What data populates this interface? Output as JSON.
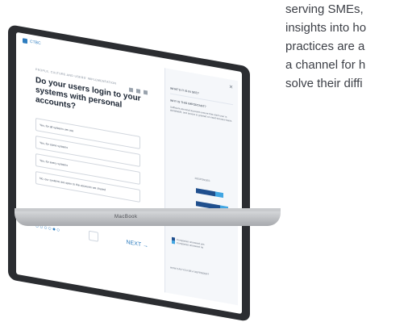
{
  "laptop_label": "MacBook",
  "brand": "CTBC",
  "question": {
    "kicker": "PEOPLE, CULTURE AND USERS' IMPLEMENTATION",
    "title": "Do your users login to your systems with personal accounts?",
    "options": [
      "Yes, for all systems we use",
      "Yes, for some systems",
      "Yes, for every systems",
      "No, our systems are open to the accounts we shared"
    ],
    "next_label": "NEXT →"
  },
  "side_panel": {
    "section1": "WHAT'S IT IS IN SEE?",
    "section2": "WHY IS THIS IMPORTANT?",
    "body": "Sufficient personal accounts ensure that each user is identifiable, and access is granted on need-to-know basis.",
    "chart_title": "RESPONSES",
    "legend": [
      "Companies answered yes",
      "Companies answered no"
    ],
    "footer": "HOW CAN YOU BE A DEFENDER?"
  },
  "right_text": [
    "serving SMEs,",
    "insights into ho",
    "practices are a",
    "a channel for h",
    "solve their diffi"
  ]
}
